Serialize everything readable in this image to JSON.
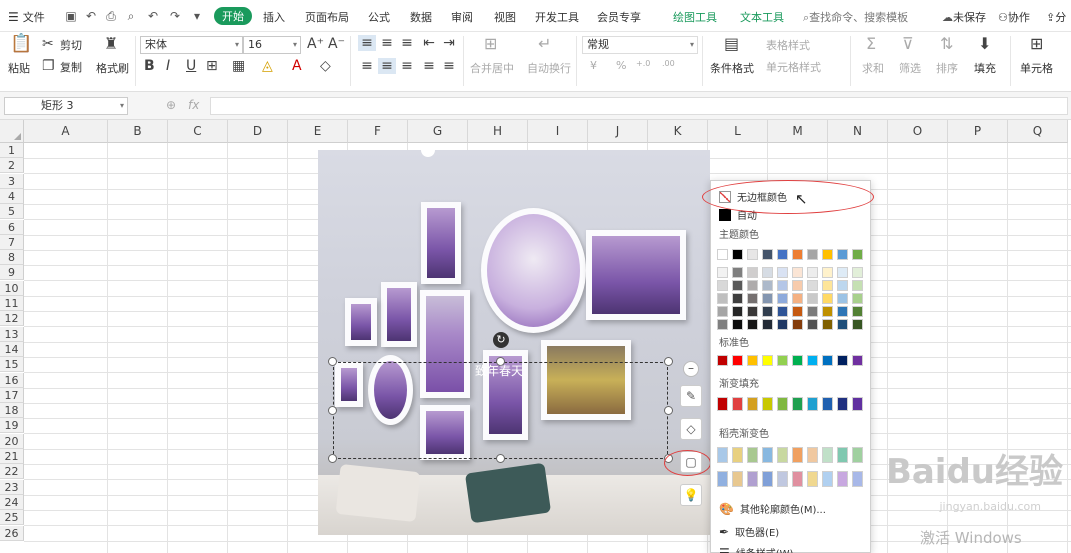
{
  "menubar": {
    "file": "文件",
    "tabs": [
      {
        "label": "开始",
        "active": true
      },
      {
        "label": "插入"
      },
      {
        "label": "页面布局"
      },
      {
        "label": "公式"
      },
      {
        "label": "数据"
      },
      {
        "label": "审阅"
      },
      {
        "label": "视图"
      },
      {
        "label": "开发工具"
      },
      {
        "label": "会员专享"
      },
      {
        "label": "绘图工具",
        "accent": true
      },
      {
        "label": "文本工具",
        "accent": true
      }
    ],
    "search_placeholder": "查找命令、搜索模板",
    "unsaved": "未保存",
    "collab": "协作",
    "share": "分"
  },
  "ribbon": {
    "paste": "粘贴",
    "cut": "剪切",
    "copy": "复制",
    "format_painter": "格式刷",
    "font": "宋体",
    "size": "16",
    "bold": "B",
    "italic": "I",
    "underline": "U",
    "merge": "合并居中",
    "wrap": "自动换行",
    "number_format": "常规",
    "currency": "¥",
    "percent": "%",
    "table_style": "表格样式",
    "cond_format": "条件格式",
    "cell_style": "单元格样式",
    "sum": "求和",
    "filter": "筛选",
    "sort": "排序",
    "fill": "填充",
    "cell": "单元格",
    "increase_decimal": "+.0",
    "decrease_decimal": ".00"
  },
  "formula_bar": {
    "name_box": "矩形 3",
    "fx": "fx",
    "zoom": "⊕"
  },
  "columns": [
    "A",
    "B",
    "C",
    "D",
    "E",
    "F",
    "G",
    "H",
    "I",
    "J",
    "K",
    "L",
    "M",
    "N",
    "O",
    "P",
    "Q"
  ],
  "rows": [
    "1",
    "2",
    "3",
    "4",
    "5",
    "6",
    "7",
    "8",
    "9",
    "10",
    "11",
    "12",
    "13",
    "14",
    "15",
    "16",
    "17",
    "18",
    "19",
    "20",
    "21",
    "22",
    "23",
    "24",
    "25",
    "26"
  ],
  "shape": {
    "text": "致年春天"
  },
  "dropdown": {
    "no_border": "无边框颜色",
    "auto": "自动",
    "theme_colors": "主题颜色",
    "standard_colors": "标准色",
    "gradient_fill": "渐变填充",
    "daoke_gradient": "稻壳渐变色",
    "more_colors": "其他轮廓颜色(M)...",
    "eyedropper": "取色器(E)",
    "line_style": "线条样式(W)",
    "theme_top": [
      "#ffffff",
      "#000000",
      "#e7e6e6",
      "#44546a",
      "#4472c4",
      "#ed7d31",
      "#a5a5a5",
      "#ffc000",
      "#5b9bd5",
      "#70ad47"
    ],
    "theme_shades": [
      [
        "#f2f2f2",
        "#7f7f7f",
        "#d0cece",
        "#d6dce4",
        "#d9e2f3",
        "#fbe5d5",
        "#ededed",
        "#fff2cc",
        "#deebf6",
        "#e2efd9"
      ],
      [
        "#d8d8d8",
        "#595959",
        "#aeabab",
        "#adb9ca",
        "#b4c6e7",
        "#f7cbac",
        "#dbdbdb",
        "#fee599",
        "#bdd7ee",
        "#c5e0b3"
      ],
      [
        "#bfbfbf",
        "#3f3f3f",
        "#757070",
        "#8496b0",
        "#8eaadb",
        "#f4b183",
        "#c9c9c9",
        "#ffd966",
        "#9cc3e5",
        "#a8d08d"
      ],
      [
        "#a5a5a5",
        "#262626",
        "#3a3838",
        "#323f4f",
        "#2f5496",
        "#c55a11",
        "#7b7b7b",
        "#bf9000",
        "#2e75b5",
        "#538135"
      ],
      [
        "#7f7f7f",
        "#0c0c0c",
        "#171616",
        "#222a35",
        "#1f3864",
        "#833c0b",
        "#525252",
        "#7f6000",
        "#1e4e79",
        "#375623"
      ]
    ],
    "standard": [
      "#c00000",
      "#ff0000",
      "#ffc000",
      "#ffff00",
      "#92d050",
      "#00b050",
      "#00b0f0",
      "#0070c0",
      "#002060",
      "#7030a0"
    ],
    "gradient": [
      "#c00000",
      "#e04040",
      "#d4a020",
      "#c8c800",
      "#80b840",
      "#20a050",
      "#20a0d0",
      "#2060b0",
      "#203080",
      "#6030a0"
    ],
    "daoke_row1": [
      "#a8c8e8",
      "#e8d080",
      "#a8c890",
      "#88b8e0",
      "#c8d8a0",
      "#f0a060",
      "#f0c8a0",
      "#c0e0c8",
      "#80c8b0",
      "#a0d0a0"
    ],
    "daoke_row2": [
      "#90b0e0",
      "#e8c890",
      "#b0a0d0",
      "#80a0d8",
      "#c0c8e0",
      "#e090a0",
      "#f0d890",
      "#b0d0f0",
      "#c8a8e0",
      "#a8b8e8"
    ]
  },
  "watermark": "Baidu经验",
  "watermark_url": "jingyan.baidu.com",
  "activate_text": "激活 Windows"
}
